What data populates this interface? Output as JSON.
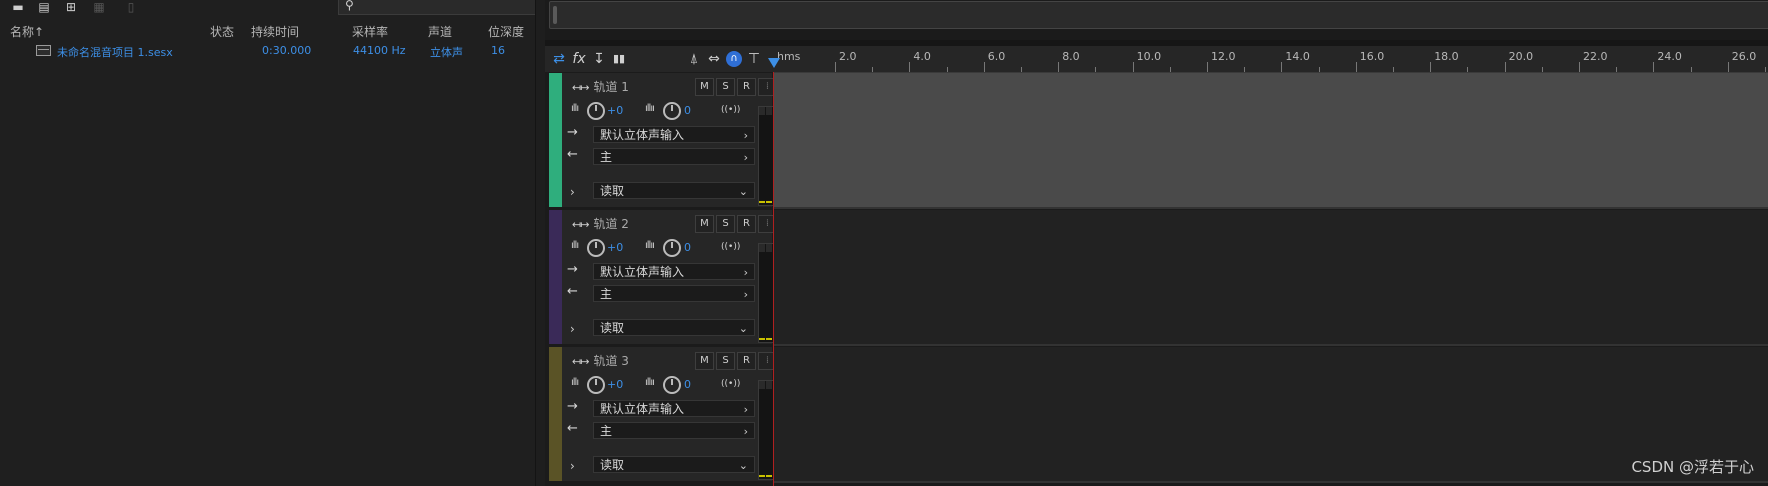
{
  "files_panel": {
    "toolbar_icons": [
      "open-folder-icon",
      "import-icon",
      "new-file-icon",
      "batch-icon",
      "delete-icon"
    ],
    "search": {
      "placeholder": "",
      "icon": "search-icon"
    },
    "columns": [
      "名称↑",
      "状态",
      "持续时间",
      "采样率",
      "声道",
      "位深度"
    ],
    "files": [
      {
        "name": "未命名混音项目 1.sesx",
        "status": "",
        "duration": "0:30.000",
        "sample_rate": "44100 Hz",
        "channels": "立体声",
        "bit_depth": "16"
      }
    ]
  },
  "editor": {
    "toolbar": [
      "⇄",
      "fx",
      "↧",
      "▮▮"
    ],
    "ruler": {
      "unit": "hms",
      "labels": [
        "2.0",
        "4.0",
        "6.0",
        "8.0",
        "10.0",
        "12.0",
        "14.0",
        "16.0",
        "18.0",
        "20.0",
        "22.0",
        "24.0",
        "26.0"
      ]
    },
    "tracks": [
      {
        "name": "轨道 1",
        "color": "#2fae7d",
        "volume": "+0",
        "pan": "0",
        "input": "默认立体声输入",
        "output": "主",
        "automation": "读取",
        "selected": true
      },
      {
        "name": "轨道 2",
        "color": "#3a2a58",
        "volume": "+0",
        "pan": "0",
        "input": "默认立体声输入",
        "output": "主",
        "automation": "读取",
        "selected": false
      },
      {
        "name": "轨道 3",
        "color": "#5a5326",
        "volume": "+0",
        "pan": "0",
        "input": "默认立体声输入",
        "output": "主",
        "automation": "读取",
        "selected": false
      }
    ],
    "buttons": {
      "mute": "M",
      "solo": "S",
      "record": "R"
    }
  },
  "watermark": "CSDN @浮若于心"
}
